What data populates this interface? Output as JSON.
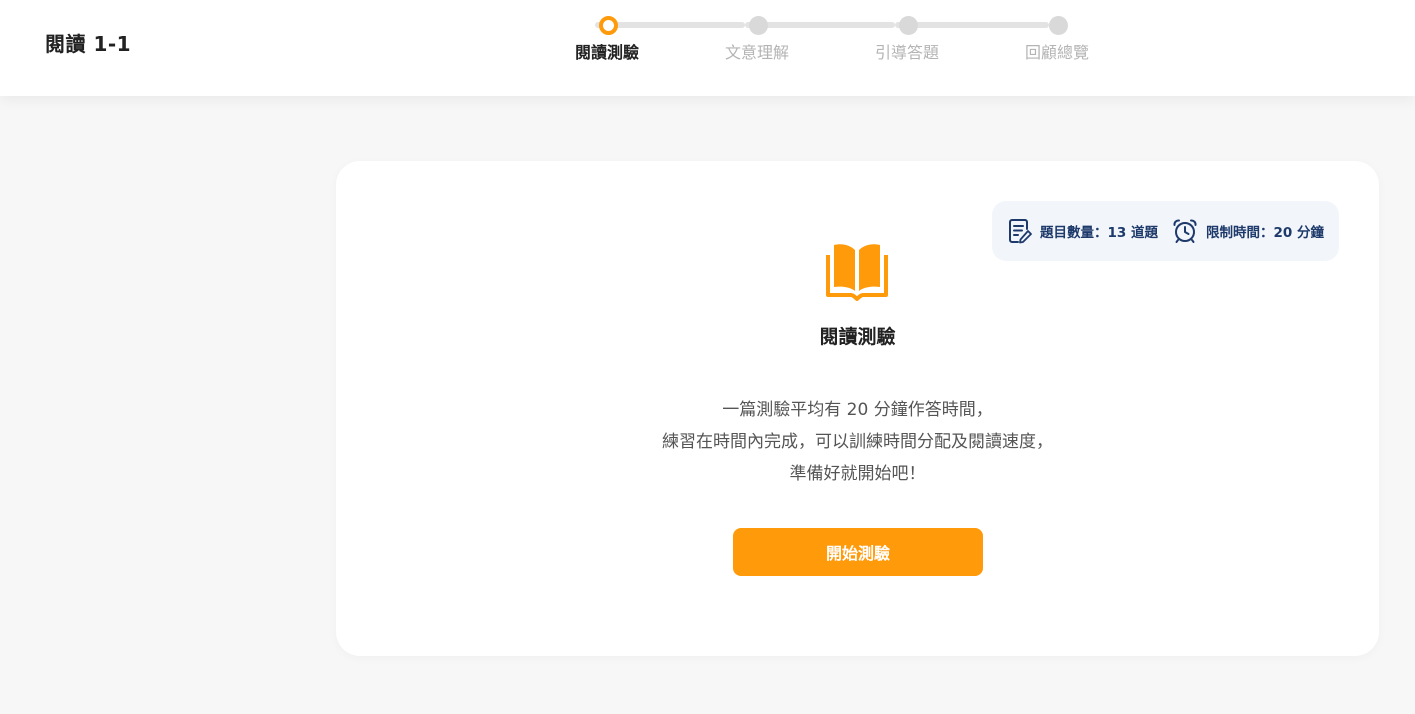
{
  "header": {
    "title": "閱讀 1-1"
  },
  "stepper": {
    "steps": [
      {
        "label": "閱讀測驗",
        "active": true
      },
      {
        "label": "文意理解",
        "active": false
      },
      {
        "label": "引導答題",
        "active": false
      },
      {
        "label": "回顧總覽",
        "active": false
      }
    ]
  },
  "info": {
    "question_count": "題目數量：13 道題",
    "time_limit": "限制時間：20 分鐘"
  },
  "card": {
    "title": "閱讀測驗",
    "description": [
      "一篇測驗平均有 20 分鐘作答時間，",
      "練習在時間內完成，可以訓練時間分配及閱讀速度，",
      "準備好就開始吧！"
    ],
    "start_button": "開始測驗",
    "icon": "open-book-icon"
  },
  "colors": {
    "accent": "#ff9a0b",
    "info_text": "#1e3a6b",
    "info_bg": "#f2f5fa"
  }
}
